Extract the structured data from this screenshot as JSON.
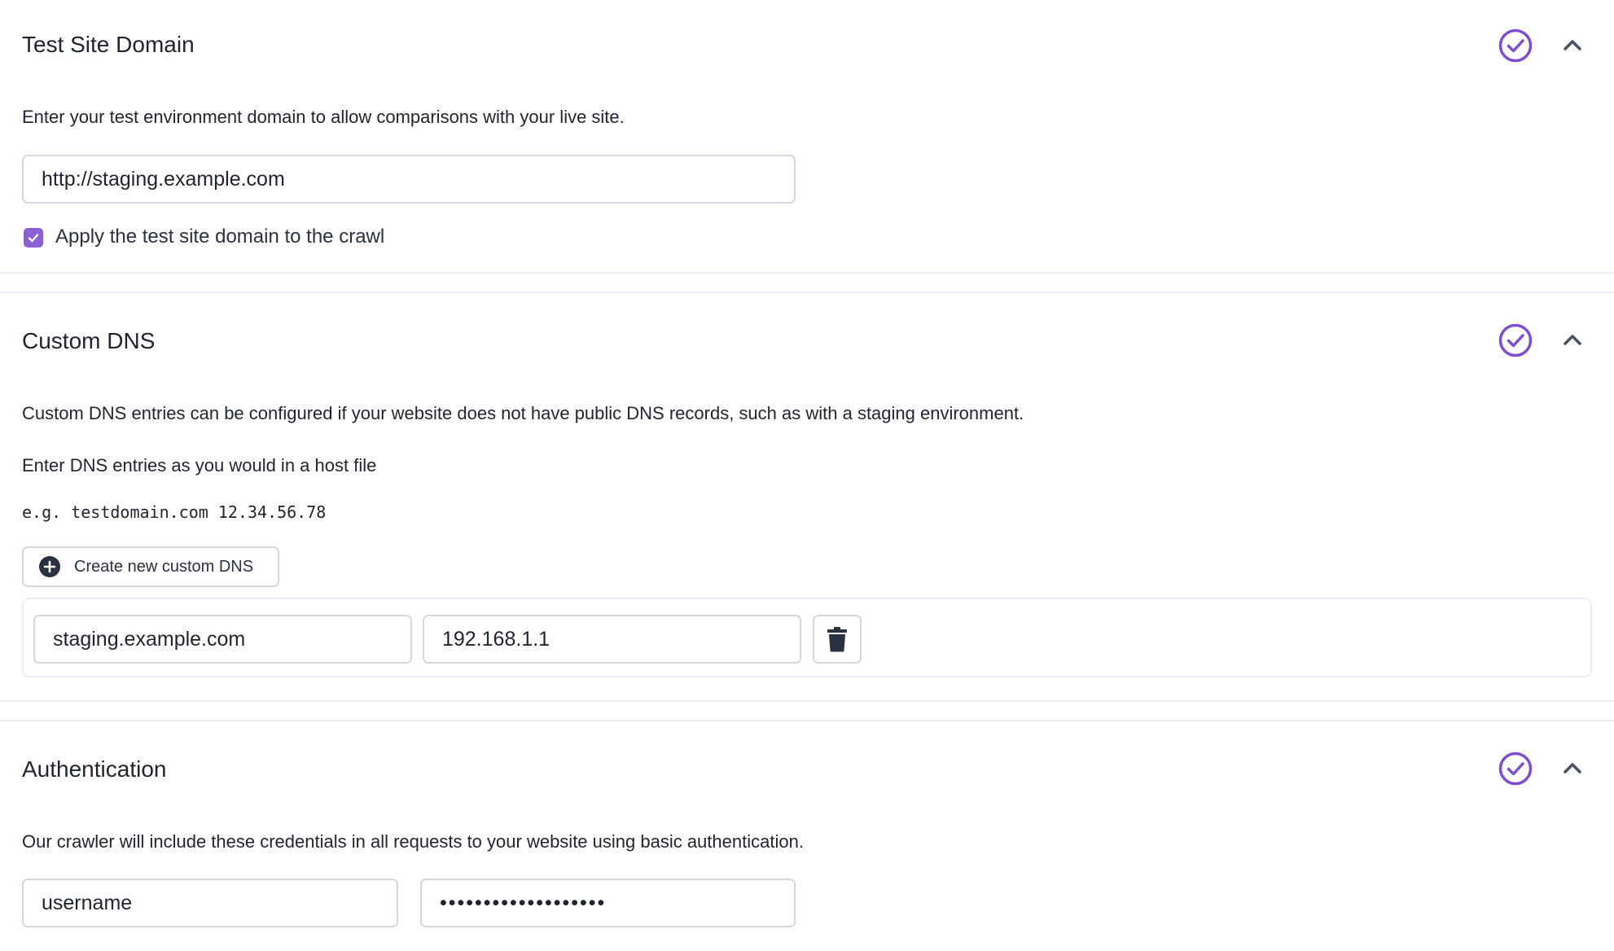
{
  "colors": {
    "accent": "#7b4fd0",
    "checkbox": "#8b5fd6",
    "text": "#1f2430",
    "border": "#d4d7de"
  },
  "test_site_domain": {
    "title": "Test Site Domain",
    "status_icon": "check-circle-icon",
    "toggle_icon": "chevron-up-icon",
    "description": "Enter your test environment domain to allow comparisons with your live site.",
    "domain_value": "http://staging.example.com",
    "apply_checkbox": {
      "checked": true,
      "label": "Apply the test site domain to the crawl"
    }
  },
  "custom_dns": {
    "title": "Custom DNS",
    "status_icon": "check-circle-icon",
    "toggle_icon": "chevron-up-icon",
    "description": "Custom DNS entries can be configured if your website does not have public DNS records, such as with a staging environment.",
    "instruction": "Enter DNS entries as you would in a host file",
    "example": "e.g. testdomain.com 12.34.56.78",
    "create_button_label": "Create new custom DNS",
    "entries": [
      {
        "hostname": "staging.example.com",
        "ip": "192.168.1.1"
      }
    ]
  },
  "authentication": {
    "title": "Authentication",
    "status_icon": "check-circle-icon",
    "toggle_icon": "chevron-up-icon",
    "description": "Our crawler will include these credentials in all requests to your website using basic authentication.",
    "username_value": "username",
    "password_value": "passwordpassword123"
  }
}
